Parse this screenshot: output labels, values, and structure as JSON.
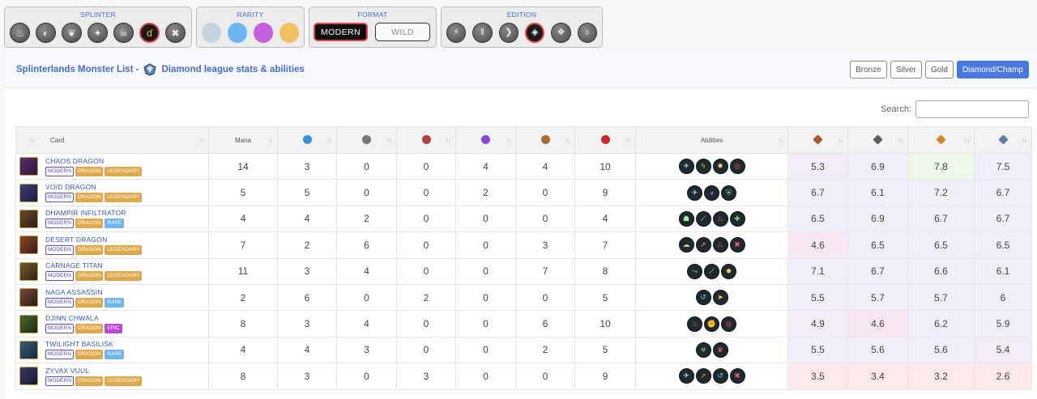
{
  "filters": {
    "splinter": {
      "title": "SPLINTER",
      "items": [
        {
          "icon": "fire-icon",
          "glyph": "♨",
          "selected": false
        },
        {
          "icon": "water-icon",
          "glyph": "◐",
          "selected": false
        },
        {
          "icon": "earth-icon",
          "glyph": "❦",
          "selected": false
        },
        {
          "icon": "life-icon",
          "glyph": "✦",
          "selected": false
        },
        {
          "icon": "death-icon",
          "glyph": "☠",
          "selected": false
        },
        {
          "icon": "dragon-icon",
          "glyph": "ɗ",
          "selected": true
        },
        {
          "icon": "neutral-icon",
          "glyph": "✖",
          "selected": false
        }
      ]
    },
    "rarity": {
      "title": "RARITY",
      "items": [
        {
          "icon": "common-icon",
          "color": "#c3d3df"
        },
        {
          "icon": "rare-icon",
          "color": "#6db5f0"
        },
        {
          "icon": "epic-icon",
          "color": "#c65fde"
        },
        {
          "icon": "legendary-icon",
          "color": "#f2c061"
        }
      ]
    },
    "format": {
      "title": "FORMAT",
      "modern": "MODERN",
      "wild": "WILD"
    },
    "edition": {
      "title": "EDITION",
      "items": [
        {
          "icon": "edition-1-icon",
          "glyph": "⚡",
          "selected": false
        },
        {
          "icon": "edition-2-icon",
          "glyph": "‖",
          "selected": false
        },
        {
          "icon": "edition-3-icon",
          "glyph": "❯",
          "selected": false
        },
        {
          "icon": "edition-4-icon",
          "glyph": "◈",
          "selected": true
        },
        {
          "icon": "edition-5-icon",
          "glyph": "❖",
          "selected": false
        },
        {
          "icon": "edition-6-icon",
          "glyph": "⬨",
          "selected": false
        }
      ]
    }
  },
  "header": {
    "title_left": "Splinterlands Monster List -",
    "title_right": "Diamond league stats & abilities",
    "leagues": [
      "Bronze",
      "Silver",
      "Gold",
      "Diamond/Champ"
    ],
    "active_league": "Diamond/Champ"
  },
  "search": {
    "label": "Search:",
    "value": ""
  },
  "table": {
    "columns": {
      "card": "Card",
      "mana": "Mana",
      "abilities": "Abilities"
    },
    "stat_icons": [
      "speed-icon",
      "melee-icon",
      "ranged-icon",
      "magic-icon",
      "armor-icon",
      "health-icon"
    ],
    "league_icons": [
      "bronze-icon",
      "silver-icon",
      "gold-icon",
      "diamond-icon"
    ],
    "rows": [
      {
        "name": "CHAOS DRAGON",
        "tags": [
          "MODERN",
          "DRAGON",
          "LEGENDARY"
        ],
        "mana": "14",
        "speed": "3",
        "melee": "0",
        "ranged": "0",
        "magic": "4",
        "armor": "4",
        "health": "10",
        "abilities": [
          "flying",
          "lightning",
          "burst",
          "target"
        ],
        "bronze": "5.3",
        "silver": "6.9",
        "gold": "7.8",
        "diamond": "7.5"
      },
      {
        "name": "VOID DRAGON",
        "tags": [
          "MODERN",
          "DRAGON",
          "LEGENDARY"
        ],
        "mana": "5",
        "speed": "5",
        "melee": "0",
        "ranged": "0",
        "magic": "2",
        "armor": "0",
        "health": "9",
        "abilities": [
          "flying",
          "void",
          "shield"
        ],
        "bronze": "6.7",
        "silver": "6.1",
        "gold": "7.2",
        "diamond": "6.7"
      },
      {
        "name": "DHAMPIR INFILTRATOR",
        "tags": [
          "MODERN",
          "DRAGON",
          "RARE"
        ],
        "mana": "4",
        "speed": "4",
        "melee": "2",
        "ranged": "0",
        "magic": "0",
        "armor": "0",
        "health": "4",
        "abilities": [
          "sneak",
          "slash",
          "fire",
          "cleanse"
        ],
        "bronze": "6.5",
        "silver": "6.9",
        "gold": "6.7",
        "diamond": "6.7"
      },
      {
        "name": "DESERT DRAGON",
        "tags": [
          "MODERN",
          "DRAGON",
          "LEGENDARY"
        ],
        "mana": "7",
        "speed": "2",
        "melee": "6",
        "ranged": "0",
        "magic": "0",
        "armor": "3",
        "health": "7",
        "abilities": [
          "dust",
          "arrow",
          "fire",
          "silence"
        ],
        "bronze": "4.6",
        "silver": "6.5",
        "gold": "6.5",
        "diamond": "6.5"
      },
      {
        "name": "CARNAGE TITAN",
        "tags": [
          "MODERN",
          "DRAGON",
          "LEGENDARY"
        ],
        "mana": "11",
        "speed": "3",
        "melee": "4",
        "ranged": "0",
        "magic": "0",
        "armor": "7",
        "health": "8",
        "abilities": [
          "trample",
          "slash",
          "burst"
        ],
        "bronze": "7.1",
        "silver": "6.7",
        "gold": "6.6",
        "diamond": "6.1"
      },
      {
        "name": "NAGA ASSASSIN",
        "tags": [
          "MODERN",
          "DRAGON",
          "RARE"
        ],
        "mana": "2",
        "speed": "6",
        "melee": "0",
        "ranged": "2",
        "magic": "0",
        "armor": "0",
        "health": "5",
        "abilities": [
          "dodge",
          "strike"
        ],
        "bronze": "5.5",
        "silver": "5.7",
        "gold": "5.7",
        "diamond": "6"
      },
      {
        "name": "DJINN CHWALA",
        "tags": [
          "MODERN",
          "DRAGON",
          "EPIC"
        ],
        "mana": "8",
        "speed": "3",
        "melee": "4",
        "ranged": "0",
        "magic": "0",
        "armor": "6",
        "health": "10",
        "abilities": [
          "fire",
          "fist",
          "target"
        ],
        "bronze": "4.9",
        "silver": "4.6",
        "gold": "6.2",
        "diamond": "5.9"
      },
      {
        "name": "TWILIGHT BASILISK",
        "tags": [
          "MODERN",
          "DRAGON",
          "RARE"
        ],
        "mana": "4",
        "speed": "4",
        "melee": "3",
        "ranged": "0",
        "magic": "0",
        "armor": "2",
        "health": "5",
        "abilities": [
          "poison",
          "rage"
        ],
        "bronze": "5.5",
        "silver": "5.6",
        "gold": "5.6",
        "diamond": "5.4"
      },
      {
        "name": "ZYVAX VUUL",
        "tags": [
          "MODERN",
          "DRAGON",
          "LEGENDARY"
        ],
        "mana": "8",
        "speed": "3",
        "melee": "0",
        "ranged": "3",
        "magic": "0",
        "armor": "0",
        "health": "9",
        "abilities": [
          "flying",
          "arrow",
          "dodge",
          "silence"
        ],
        "bronze": "3.5",
        "silver": "3.4",
        "gold": "3.2",
        "diamond": "2.6"
      }
    ]
  },
  "colors": {
    "accent": "#4a6cc7",
    "active_button": "#4a78e0",
    "selected_ring": "#e04848"
  }
}
